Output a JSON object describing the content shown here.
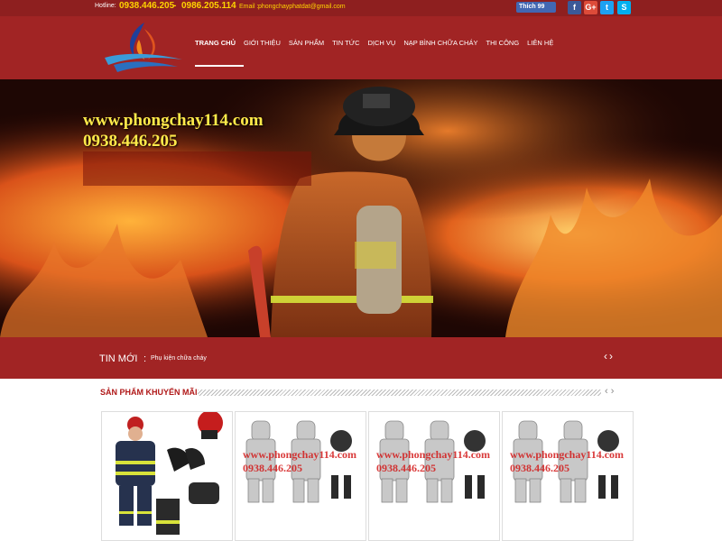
{
  "topbar": {
    "hotline_label": "Hotline:",
    "phone1": "0938.446.205",
    "separator": "-",
    "phone2": "0986.205.114",
    "email_label": "Email :",
    "email": "phongchayphatdat@gmail.com",
    "like_label": "Thích 99",
    "social": [
      {
        "name": "facebook",
        "glyph": "f",
        "color": "#3b5998"
      },
      {
        "name": "google-plus",
        "glyph": "G+",
        "color": "#dd4b39"
      },
      {
        "name": "twitter",
        "glyph": "t",
        "color": "#1da1f2"
      },
      {
        "name": "skype",
        "glyph": "S",
        "color": "#00aff0"
      }
    ]
  },
  "nav": {
    "items": [
      "TRANG CHỦ",
      "GIỚI THIỆU",
      "SẢN PHẨM",
      "TIN TỨC",
      "DỊCH VỤ",
      "NẠP BÌNH CHỮA CHÁY",
      "THI CÔNG",
      "LIÊN HỆ"
    ]
  },
  "hero": {
    "url": "www.phongchay114.com",
    "phone": "0938.446.205"
  },
  "news": {
    "title": "TIN MỚI",
    "colon": ":",
    "item": "Phụ kiện chữa cháy"
  },
  "promo": {
    "title": "SẢN PHẨM KHUYẾN MÃI"
  },
  "products": [
    {
      "watermark_url": "",
      "watermark_phone": ""
    },
    {
      "watermark_url": "www.phongchay114.com",
      "watermark_phone": "0938.446.205"
    },
    {
      "watermark_url": "www.phongchay114.com",
      "watermark_phone": "0938.446.205"
    },
    {
      "watermark_url": "www.phongchay114.com",
      "watermark_phone": "0938.446.205"
    }
  ],
  "colors": {
    "brand_red": "#a12424",
    "topbar_red": "#8e1f1f",
    "accent_yellow": "#ffd400"
  }
}
